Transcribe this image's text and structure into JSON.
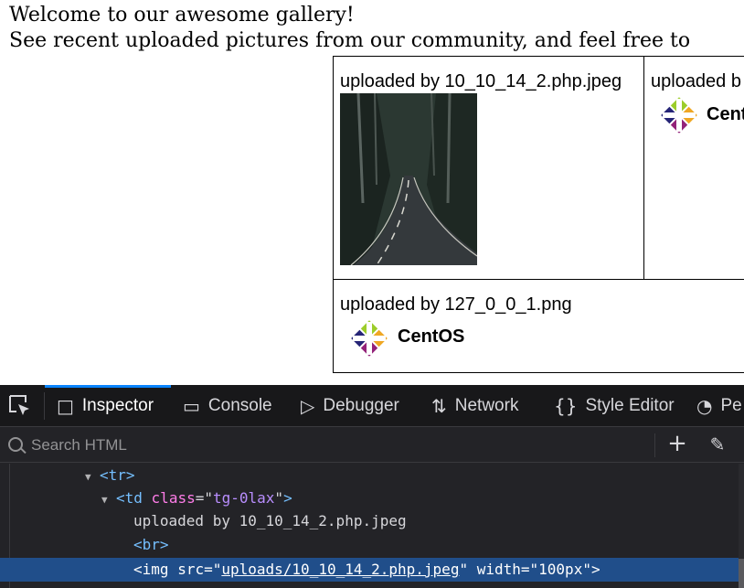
{
  "page": {
    "welcome_line1": "Welcome to our awesome gallery!",
    "welcome_line2": "See recent uploaded pictures from our community, and feel free to"
  },
  "gallery": {
    "cells": [
      {
        "caption": "uploaded by 10_10_14_2.php.jpeg",
        "image": "road-photo"
      },
      {
        "caption": "uploaded b",
        "image": "centos-logo",
        "logo_text": "Cent"
      },
      {
        "caption": "uploaded by 127_0_0_1.png",
        "image": "centos-logo",
        "logo_text": "CentOS"
      }
    ]
  },
  "devtools": {
    "tabs": [
      {
        "label": "Inspector",
        "icon": "inspector-icon",
        "active": true
      },
      {
        "label": "Console",
        "icon": "console-icon"
      },
      {
        "label": "Debugger",
        "icon": "debugger-icon"
      },
      {
        "label": "Network",
        "icon": "network-icon"
      },
      {
        "label": "Style Editor",
        "icon": "style-editor-icon"
      },
      {
        "label": "Pe",
        "icon": "performance-icon"
      }
    ],
    "search_placeholder": "Search HTML",
    "tree": {
      "tr_tag": "tr",
      "td_tag": "td",
      "td_attr_name": "class",
      "td_attr_value": "tg-0lax",
      "text_node": "uploaded by 10_10_14_2.php.jpeg",
      "br_tag": "<br>",
      "img_tag": "img",
      "img_src_name": "src",
      "img_src_value": "uploads/10_10_14_2.php.jpeg",
      "img_width_name": "width",
      "img_width_value": "100px"
    }
  }
}
